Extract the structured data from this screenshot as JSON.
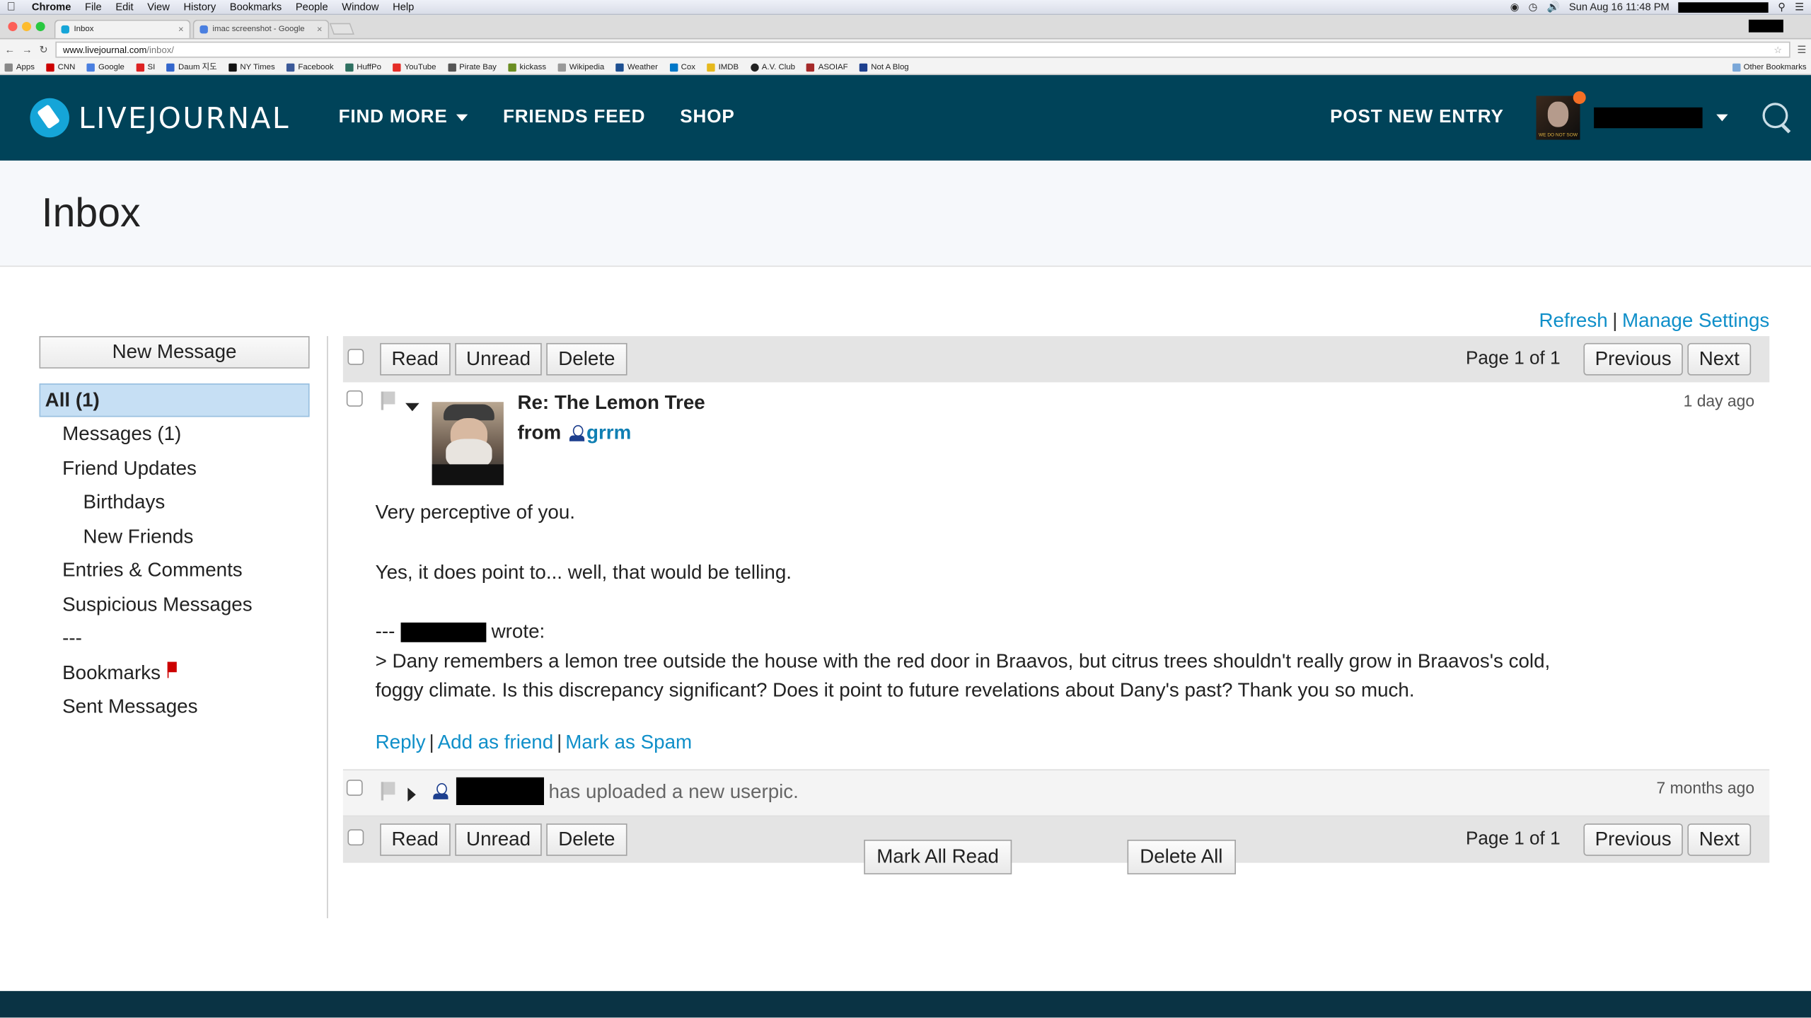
{
  "mac_menu": {
    "app": "Chrome",
    "items": [
      "File",
      "Edit",
      "View",
      "History",
      "Bookmarks",
      "People",
      "Window",
      "Help"
    ],
    "clock": "Sun Aug 16  11:48 PM"
  },
  "tabs": [
    {
      "label": "Inbox"
    },
    {
      "label": "imac screenshot - Google"
    }
  ],
  "omnibox": {
    "domain": "www.livejournal.com",
    "path": "/inbox/"
  },
  "bookmarks": {
    "items": [
      "Apps",
      "CNN",
      "Google",
      "SI",
      "Daum 지도",
      "NY Times",
      "Facebook",
      "HuffPo",
      "YouTube",
      "Pirate Bay",
      "kickass",
      "Wikipedia",
      "Weather",
      "Cox",
      "IMDB",
      "A.V. Club",
      "ASOIAF",
      "Not A Blog"
    ],
    "other": "Other Bookmarks"
  },
  "header": {
    "logo": "LIVEJOURNAL",
    "nav": {
      "find_more": "FIND MORE",
      "friends_feed": "FRIENDS FEED",
      "shop": "SHOP"
    },
    "post_new": "POST NEW ENTRY",
    "avatar_caption": "WE DO NOT SOW"
  },
  "page": {
    "title": "Inbox"
  },
  "top_links": {
    "refresh": "Refresh",
    "separator": "|",
    "manage": "Manage Settings"
  },
  "sidebar": {
    "new_message": "New Message",
    "all": "All (1)",
    "items": {
      "messages": "Messages (1)",
      "friend_updates": "Friend Updates",
      "birthdays": "Birthdays",
      "new_friends": "New Friends",
      "entries_comments": "Entries & Comments",
      "suspicious": "Suspicious Messages",
      "divider": "---",
      "bookmarks": "Bookmarks",
      "sent": "Sent Messages"
    }
  },
  "toolbar": {
    "read": "Read",
    "unread": "Unread",
    "delete": "Delete",
    "page_info": "Page 1 of 1",
    "previous": "Previous",
    "next": "Next"
  },
  "message1": {
    "subject": "Re: The Lemon Tree",
    "from_label": "from",
    "from_user": "grrm",
    "time": "1 day ago",
    "line1": "Very perceptive of you.",
    "line2": "Yes, it does point to... well, that would be telling.",
    "quote_prefix": "---",
    "quote_suffix": "wrote:",
    "quote": "> Dany remembers a lemon tree outside the house with the red door in Braavos, but citrus trees shouldn't really grow in Braavos's cold, foggy climate. Is this discrepancy significant? Does it point to future revelations about Dany's past? Thank you so much.",
    "actions": {
      "reply": "Reply",
      "add_friend": "Add as friend",
      "spam": "Mark as Spam",
      "separator": "|"
    }
  },
  "message2": {
    "text": "has uploaded a new userpic.",
    "time": "7 months ago"
  },
  "bottom": {
    "mark_all_read": "Mark All Read",
    "delete_all": "Delete All"
  }
}
